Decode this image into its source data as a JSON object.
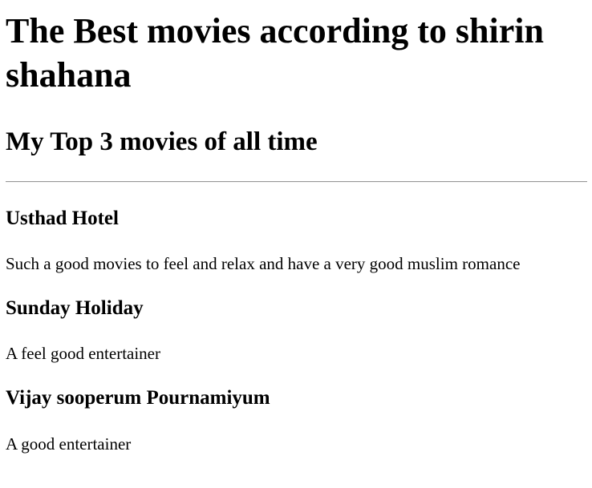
{
  "page": {
    "title": "The Best movies according to shirin shahana",
    "subtitle": "My Top 3 movies of all time"
  },
  "movies": [
    {
      "title": "Usthad Hotel",
      "description": "Such a good movies to feel and relax and have a very good muslim romance"
    },
    {
      "title": "Sunday Holiday",
      "description": "A feel good entertainer"
    },
    {
      "title": "Vijay sooperum Pournamiyum",
      "description": "A good entertainer"
    }
  ]
}
